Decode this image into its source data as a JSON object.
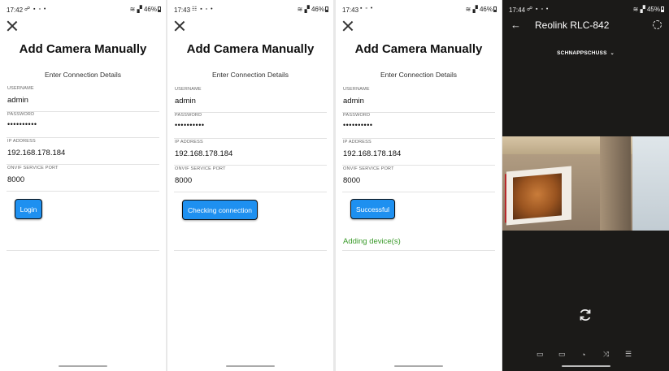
{
  "screens": [
    {
      "status_time": "17:42",
      "status_battery": "46%",
      "title": "Add Camera Manually",
      "subtitle": "Enter Connection Details",
      "fields": [
        {
          "label": "USERNAME",
          "value": "admin"
        },
        {
          "label": "PASSWORD",
          "value": "••••••••••"
        },
        {
          "label": "IP ADDRESS",
          "value": "192.168.178.184"
        },
        {
          "label": "ONVIF SERVICE PORT",
          "value": "8000"
        }
      ],
      "button_label": "Login",
      "message": ""
    },
    {
      "status_time": "17:43",
      "status_battery": "46%",
      "title": "Add Camera Manually",
      "subtitle": "Enter Connection Details",
      "fields": [
        {
          "label": "USERNAME",
          "value": "admin"
        },
        {
          "label": "PASSWORD",
          "value": "••••••••••"
        },
        {
          "label": "IP ADDRESS",
          "value": "192.168.178.184"
        },
        {
          "label": "ONVIF SERVICE PORT",
          "value": "8000"
        }
      ],
      "button_label": "Checking connection",
      "message": ""
    },
    {
      "status_time": "17:43",
      "status_battery": "46%",
      "title": "Add Camera Manually",
      "subtitle": "Enter Connection Details",
      "fields": [
        {
          "label": "USERNAME",
          "value": "admin"
        },
        {
          "label": "PASSWORD",
          "value": "••••••••••"
        },
        {
          "label": "IP ADDRESS",
          "value": "192.168.178.184"
        },
        {
          "label": "ONVIF SERVICE PORT",
          "value": "8000"
        }
      ],
      "button_label": "Successful",
      "message": "Adding device(s)"
    }
  ],
  "camera_view": {
    "status_time": "17:44",
    "status_battery": "45%",
    "title": "Reolink RLC-842",
    "snapshot_label": "SCHNAPPSCHUSS",
    "controls": [
      "video-camera-icon",
      "battery-icon",
      "speed-gauge-icon",
      "shuffle-icon",
      "list-settings-icon"
    ]
  },
  "colors": {
    "accent": "#1e90f0",
    "success_text": "#3a9a2a",
    "camera_bg": "#1b1a18"
  },
  "icons": [
    "close-icon",
    "back-arrow-icon",
    "gear-icon",
    "chevron-down-icon",
    "refresh-icon",
    "wifi-icon",
    "signal-icon",
    "battery-icon"
  ]
}
